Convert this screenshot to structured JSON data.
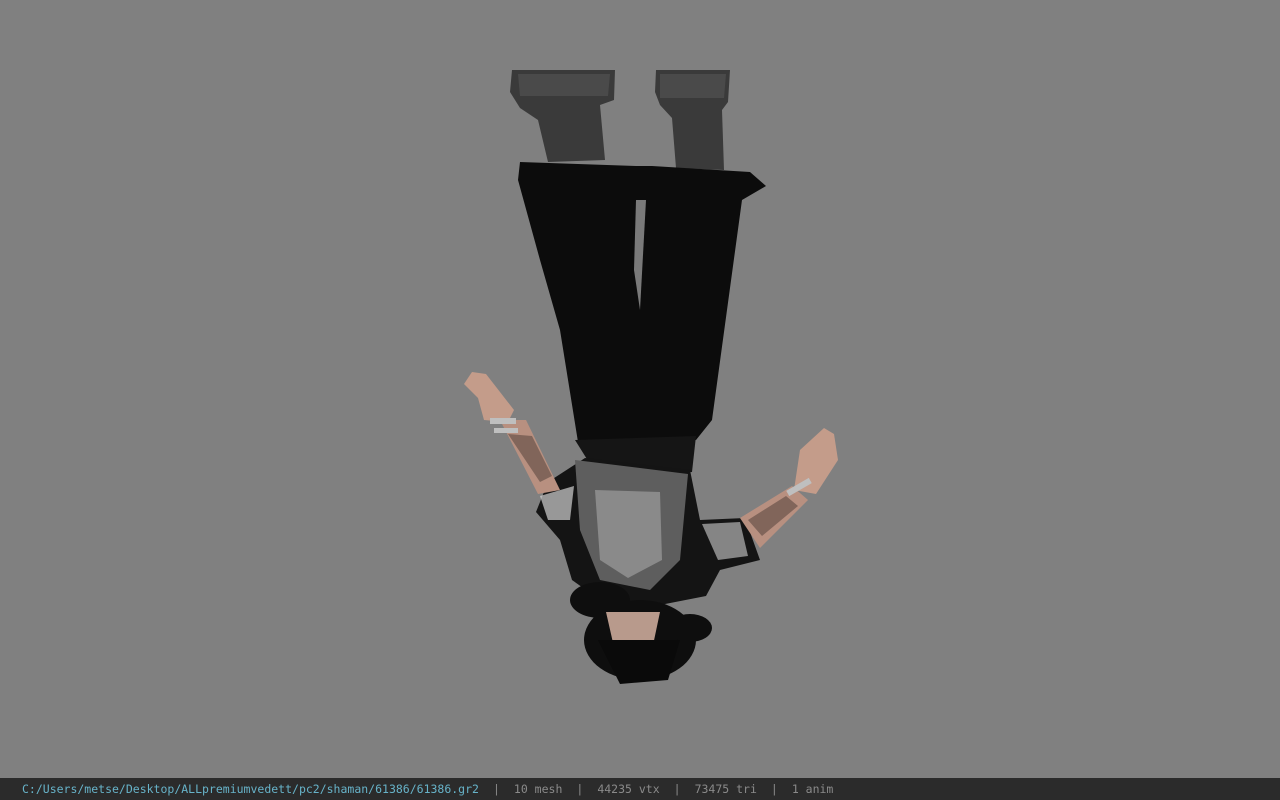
{
  "viewport": {
    "background": "#808080",
    "model_name": "character-model-upside-down"
  },
  "status": {
    "path": "C:/Users/metse/Desktop/ALLpremiumvedett/pc2/shaman/61386/61386.gr2",
    "mesh": "10 mesh",
    "vtx": "44235 vtx",
    "tri": "73475 tri",
    "anim": "1 anim",
    "separator": "|",
    "path_color": "#67b3c9",
    "bar_color": "#2b2b2b"
  }
}
